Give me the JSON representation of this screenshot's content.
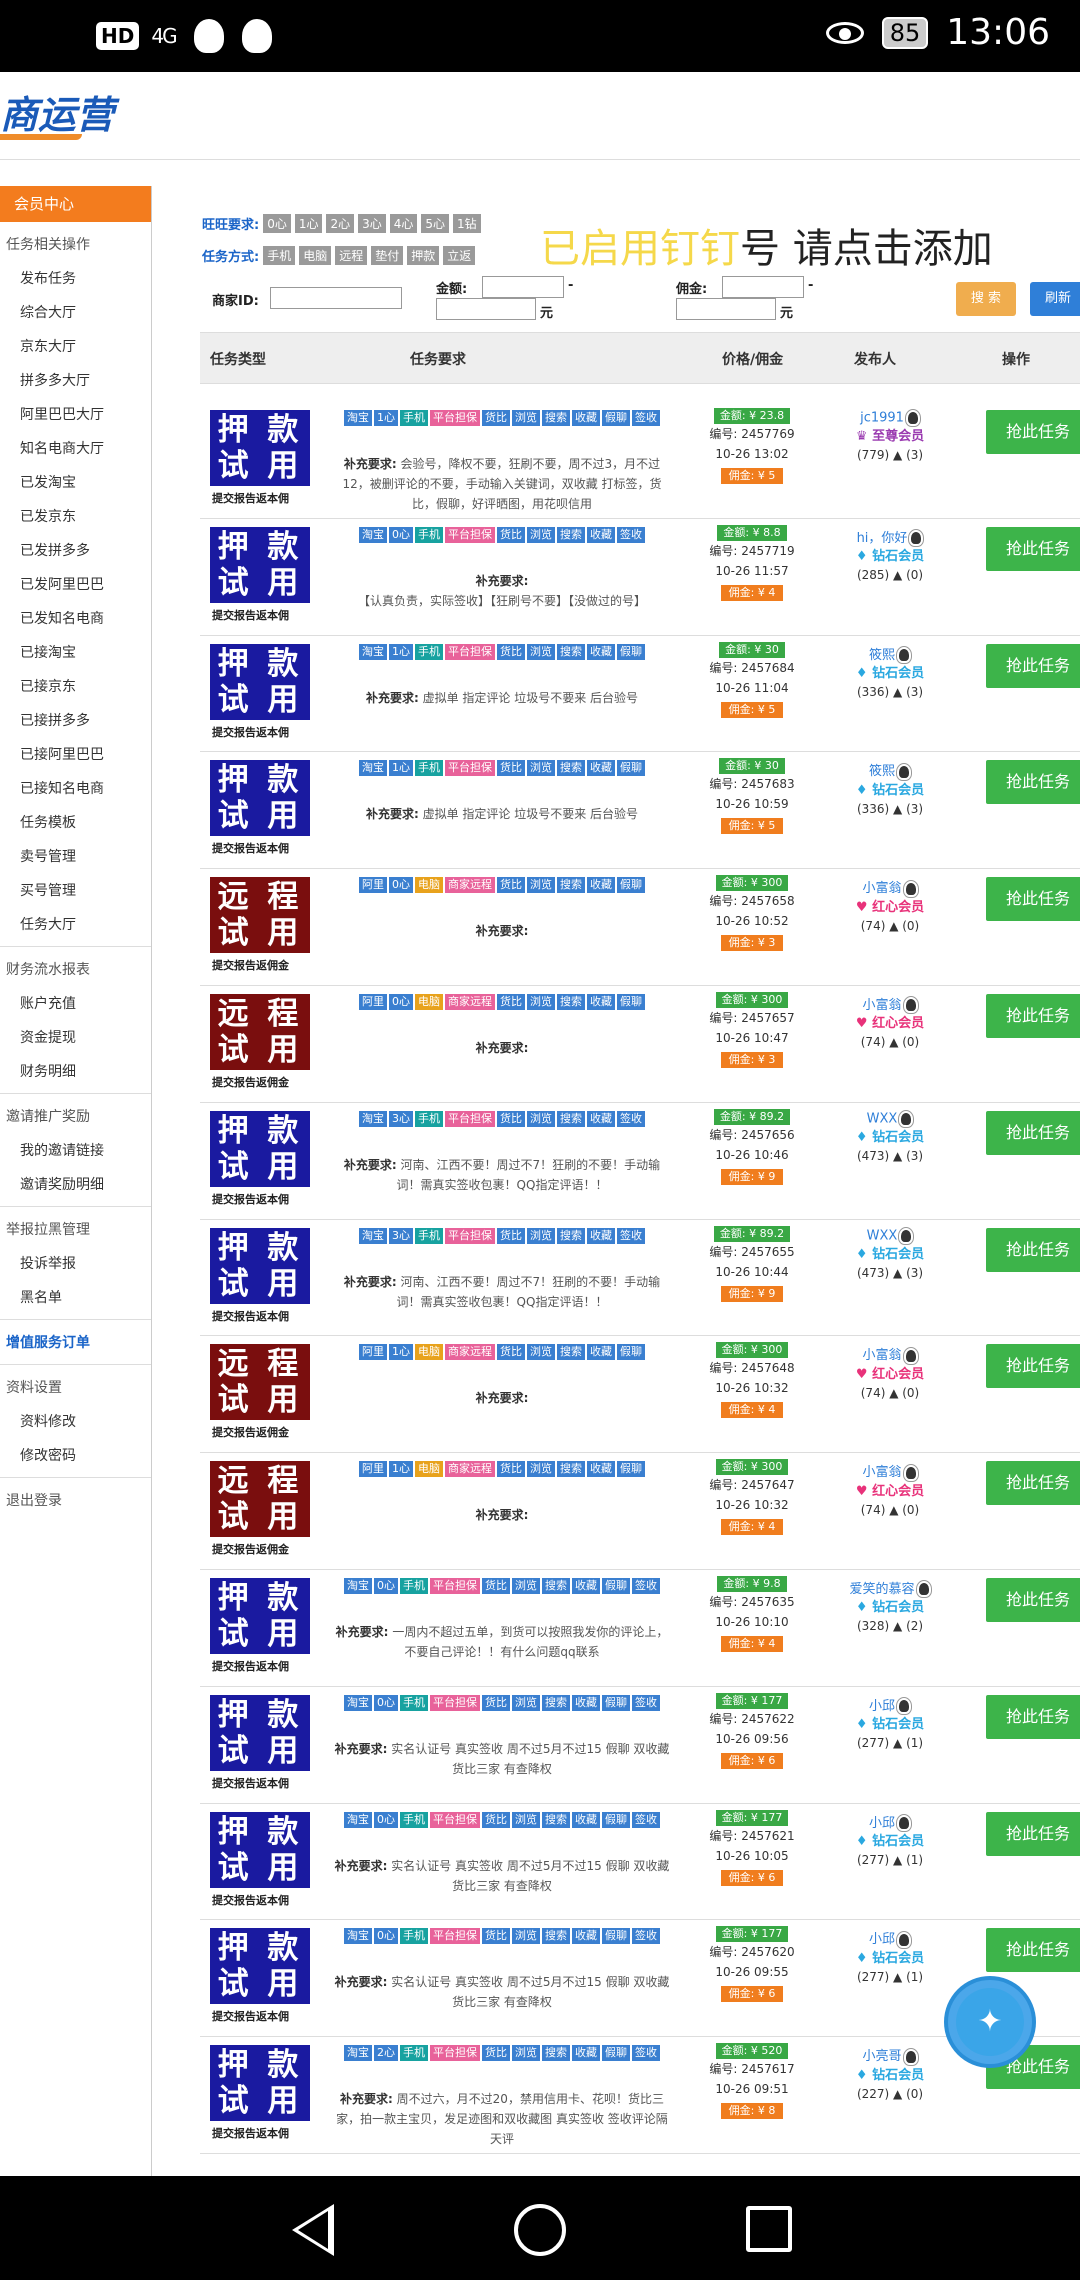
{
  "status_bar": {
    "hd": "HD",
    "signal": "4G",
    "battery": "85",
    "time": "13:06"
  },
  "header": {
    "logo": "商运营"
  },
  "sidebar": {
    "active": "会员中心",
    "groups": [
      {
        "title": "任务相关操作",
        "items": [
          "发布任务",
          "综合大厅",
          "京东大厅",
          "拼多多大厅",
          "阿里巴巴大厅",
          "知名电商大厅",
          "已发淘宝",
          "已发京东",
          "已发拼多多",
          "已发阿里巴巴",
          "已发知名电商",
          "已接淘宝",
          "已接京东",
          "已接拼多多",
          "已接阿里巴巴",
          "已接知名电商",
          "任务模板",
          "卖号管理",
          "买号管理",
          "任务大厅"
        ]
      },
      {
        "title": "财务流水报表",
        "items": [
          "账户充值",
          "资金提现",
          "财务明细"
        ]
      },
      {
        "title": "邀请推广奖励",
        "items": [
          "我的邀请链接",
          "邀请奖励明细"
        ]
      },
      {
        "title": "举报拉黑管理",
        "items": [
          "投诉举报",
          "黑名单"
        ]
      },
      {
        "title": "增值服务订单",
        "items": []
      },
      {
        "title": "资料设置",
        "items": [
          "资料修改",
          "修改密码"
        ]
      },
      {
        "title": "退出登录",
        "items": []
      }
    ]
  },
  "filters": {
    "wangwang_label": "旺旺要求:",
    "wangwang_chips": [
      "0心",
      "1心",
      "2心",
      "3心",
      "4心",
      "5心",
      "1钻"
    ],
    "method_label": "任务方式:",
    "method_chips": [
      "手机",
      "电脑",
      "远程",
      "垫付",
      "押款",
      "立返"
    ],
    "merchant_label": "商家ID:",
    "amount_label": "金额:",
    "commission_label": "佣金:",
    "dash": "-",
    "unit": "元",
    "search_btn": "搜 索",
    "refresh_btn": "刷新",
    "banner_yellow": "已启用钉钉",
    "banner_black": "号  请点击添加"
  },
  "table_header": {
    "type": "任务类型",
    "req": "任务要求",
    "price": "价格/佣金",
    "publisher": "发布人",
    "action": "操作"
  },
  "labels": {
    "req_prefix": "补充要求:",
    "id_prefix": "编号:",
    "grab": "抢此任务"
  },
  "rows": [
    {
      "badge": [
        "押 款",
        "试 用"
      ],
      "badge_color": "blue",
      "badge_sub": "提交报告返本佣",
      "tags": [
        [
          "淘宝",
          "blue"
        ],
        [
          "1心",
          "blue"
        ],
        [
          "手机",
          "teal"
        ],
        [
          "平台担保",
          "pink"
        ],
        [
          "货比",
          "blue"
        ],
        [
          "浏览",
          "blue"
        ],
        [
          "搜索",
          "blue"
        ],
        [
          "收藏",
          "blue"
        ],
        [
          "假聊",
          "blue"
        ],
        [
          "签收",
          "blue"
        ]
      ],
      "req": "会验号，降权不要，狂刷不要，周不过3，月不过12，被删评论的不要，手动输入关键词，双收藏 打标签，货比，假聊，好评晒图，用花呗信用",
      "amount": "金额: ¥ 23.8",
      "id": "2457769",
      "time": "10-26 13:02",
      "fee": "佣金: ¥ 5",
      "name": "jc1991",
      "level": "至尊会员",
      "level_type": "vip",
      "stats": "(779) ▲ (3)"
    },
    {
      "badge": [
        "押 款",
        "试 用"
      ],
      "badge_color": "blue",
      "badge_sub": "提交报告返本佣",
      "tags": [
        [
          "淘宝",
          "blue"
        ],
        [
          "0心",
          "blue"
        ],
        [
          "手机",
          "teal"
        ],
        [
          "平台担保",
          "pink"
        ],
        [
          "货比",
          "blue"
        ],
        [
          "浏览",
          "blue"
        ],
        [
          "搜索",
          "blue"
        ],
        [
          "收藏",
          "blue"
        ],
        [
          "签收",
          "blue"
        ]
      ],
      "req": "【认真负责，实际签收】【狂刷号不要】【没做过的号】",
      "amount": "金额: ¥ 8.8",
      "id": "2457719",
      "time": "10-26 11:57",
      "fee": "佣金: ¥ 4",
      "name": "hi，你好",
      "level": "钻石会员",
      "level_type": "diamond",
      "stats": "(285) ▲ (0)"
    },
    {
      "badge": [
        "押 款",
        "试 用"
      ],
      "badge_color": "blue",
      "badge_sub": "提交报告返本佣",
      "tags": [
        [
          "淘宝",
          "blue"
        ],
        [
          "1心",
          "blue"
        ],
        [
          "手机",
          "teal"
        ],
        [
          "平台担保",
          "pink"
        ],
        [
          "货比",
          "blue"
        ],
        [
          "浏览",
          "blue"
        ],
        [
          "搜索",
          "blue"
        ],
        [
          "收藏",
          "blue"
        ],
        [
          "假聊",
          "blue"
        ]
      ],
      "req": "虚拟单 指定评论 垃圾号不要来 后台验号",
      "amount": "金额: ¥ 30",
      "id": "2457684",
      "time": "10-26 11:04",
      "fee": "佣金: ¥ 5",
      "name": "筱熙",
      "level": "钻石会员",
      "level_type": "diamond",
      "stats": "(336) ▲ (3)"
    },
    {
      "badge": [
        "押 款",
        "试 用"
      ],
      "badge_color": "blue",
      "badge_sub": "提交报告返本佣",
      "tags": [
        [
          "淘宝",
          "blue"
        ],
        [
          "1心",
          "blue"
        ],
        [
          "手机",
          "teal"
        ],
        [
          "平台担保",
          "pink"
        ],
        [
          "货比",
          "blue"
        ],
        [
          "浏览",
          "blue"
        ],
        [
          "搜索",
          "blue"
        ],
        [
          "收藏",
          "blue"
        ],
        [
          "假聊",
          "blue"
        ]
      ],
      "req": "虚拟单 指定评论 垃圾号不要来 后台验号",
      "amount": "金额: ¥ 30",
      "id": "2457683",
      "time": "10-26 10:59",
      "fee": "佣金: ¥ 5",
      "name": "筱熙",
      "level": "钻石会员",
      "level_type": "diamond",
      "stats": "(336) ▲ (3)"
    },
    {
      "badge": [
        "远 程",
        "试 用"
      ],
      "badge_color": "red",
      "badge_sub": "提交报告返佣金",
      "tags": [
        [
          "阿里",
          "blue"
        ],
        [
          "0心",
          "blue"
        ],
        [
          "电脑",
          "org"
        ],
        [
          "商家远程",
          "pink"
        ],
        [
          "货比",
          "blue"
        ],
        [
          "浏览",
          "blue"
        ],
        [
          "搜索",
          "blue"
        ],
        [
          "收藏",
          "blue"
        ],
        [
          "假聊",
          "blue"
        ]
      ],
      "req": "",
      "amount": "金额: ¥ 300",
      "id": "2457658",
      "time": "10-26 10:52",
      "fee": "佣金: ¥ 3",
      "name": "小富翁",
      "level": "红心会员",
      "level_type": "heart",
      "stats": "(74) ▲ (0)"
    },
    {
      "badge": [
        "远 程",
        "试 用"
      ],
      "badge_color": "red",
      "badge_sub": "提交报告返佣金",
      "tags": [
        [
          "阿里",
          "blue"
        ],
        [
          "0心",
          "blue"
        ],
        [
          "电脑",
          "org"
        ],
        [
          "商家远程",
          "pink"
        ],
        [
          "货比",
          "blue"
        ],
        [
          "浏览",
          "blue"
        ],
        [
          "搜索",
          "blue"
        ],
        [
          "收藏",
          "blue"
        ],
        [
          "假聊",
          "blue"
        ]
      ],
      "req": "",
      "amount": "金额: ¥ 300",
      "id": "2457657",
      "time": "10-26 10:47",
      "fee": "佣金: ¥ 3",
      "name": "小富翁",
      "level": "红心会员",
      "level_type": "heart",
      "stats": "(74) ▲ (0)"
    },
    {
      "badge": [
        "押 款",
        "试 用"
      ],
      "badge_color": "blue",
      "badge_sub": "提交报告返本佣",
      "tags": [
        [
          "淘宝",
          "blue"
        ],
        [
          "3心",
          "blue"
        ],
        [
          "手机",
          "teal"
        ],
        [
          "平台担保",
          "pink"
        ],
        [
          "货比",
          "blue"
        ],
        [
          "浏览",
          "blue"
        ],
        [
          "搜索",
          "blue"
        ],
        [
          "收藏",
          "blue"
        ],
        [
          "签收",
          "blue"
        ]
      ],
      "req": "河南、江西不要！周过不7！狂刷的不要！手动输词！需真实签收包裹！QQ指定评语！！",
      "amount": "金额: ¥ 89.2",
      "id": "2457656",
      "time": "10-26 10:46",
      "fee": "佣金: ¥ 9",
      "name": "WXX",
      "level": "钻石会员",
      "level_type": "diamond",
      "stats": "(473) ▲ (3)"
    },
    {
      "badge": [
        "押 款",
        "试 用"
      ],
      "badge_color": "blue",
      "badge_sub": "提交报告返本佣",
      "tags": [
        [
          "淘宝",
          "blue"
        ],
        [
          "3心",
          "blue"
        ],
        [
          "手机",
          "teal"
        ],
        [
          "平台担保",
          "pink"
        ],
        [
          "货比",
          "blue"
        ],
        [
          "浏览",
          "blue"
        ],
        [
          "搜索",
          "blue"
        ],
        [
          "收藏",
          "blue"
        ],
        [
          "签收",
          "blue"
        ]
      ],
      "req": "河南、江西不要！周过不7！狂刷的不要！手动输词！需真实签收包裹！QQ指定评语！！",
      "amount": "金额: ¥ 89.2",
      "id": "2457655",
      "time": "10-26 10:44",
      "fee": "佣金: ¥ 9",
      "name": "WXX",
      "level": "钻石会员",
      "level_type": "diamond",
      "stats": "(473) ▲ (3)"
    },
    {
      "badge": [
        "远 程",
        "试 用"
      ],
      "badge_color": "red",
      "badge_sub": "提交报告返佣金",
      "tags": [
        [
          "阿里",
          "blue"
        ],
        [
          "1心",
          "blue"
        ],
        [
          "电脑",
          "org"
        ],
        [
          "商家远程",
          "pink"
        ],
        [
          "货比",
          "blue"
        ],
        [
          "浏览",
          "blue"
        ],
        [
          "搜索",
          "blue"
        ],
        [
          "收藏",
          "blue"
        ],
        [
          "假聊",
          "blue"
        ]
      ],
      "req": "",
      "amount": "金额: ¥ 300",
      "id": "2457648",
      "time": "10-26 10:32",
      "fee": "佣金: ¥ 4",
      "name": "小富翁",
      "level": "红心会员",
      "level_type": "heart",
      "stats": "(74) ▲ (0)"
    },
    {
      "badge": [
        "远 程",
        "试 用"
      ],
      "badge_color": "red",
      "badge_sub": "提交报告返佣金",
      "tags": [
        [
          "阿里",
          "blue"
        ],
        [
          "1心",
          "blue"
        ],
        [
          "电脑",
          "org"
        ],
        [
          "商家远程",
          "pink"
        ],
        [
          "货比",
          "blue"
        ],
        [
          "浏览",
          "blue"
        ],
        [
          "搜索",
          "blue"
        ],
        [
          "收藏",
          "blue"
        ],
        [
          "假聊",
          "blue"
        ]
      ],
      "req": "",
      "amount": "金额: ¥ 300",
      "id": "2457647",
      "time": "10-26 10:32",
      "fee": "佣金: ¥ 4",
      "name": "小富翁",
      "level": "红心会员",
      "level_type": "heart",
      "stats": "(74) ▲ (0)"
    },
    {
      "badge": [
        "押 款",
        "试 用"
      ],
      "badge_color": "blue",
      "badge_sub": "提交报告返本佣",
      "tags": [
        [
          "淘宝",
          "blue"
        ],
        [
          "0心",
          "blue"
        ],
        [
          "手机",
          "teal"
        ],
        [
          "平台担保",
          "pink"
        ],
        [
          "货比",
          "blue"
        ],
        [
          "浏览",
          "blue"
        ],
        [
          "搜索",
          "blue"
        ],
        [
          "收藏",
          "blue"
        ],
        [
          "假聊",
          "blue"
        ],
        [
          "签收",
          "blue"
        ]
      ],
      "req": "一周内不超过五单，到货可以按照我发你的评论上，不要自己评论！！有什么问题qq联系",
      "amount": "金额: ¥ 9.8",
      "id": "2457635",
      "time": "10-26 10:10",
      "fee": "佣金: ¥ 4",
      "name": "爱笑的慕容",
      "level": "钻石会员",
      "level_type": "diamond",
      "stats": "(328) ▲ (2)"
    },
    {
      "badge": [
        "押 款",
        "试 用"
      ],
      "badge_color": "blue",
      "badge_sub": "提交报告返本佣",
      "tags": [
        [
          "淘宝",
          "blue"
        ],
        [
          "0心",
          "blue"
        ],
        [
          "手机",
          "teal"
        ],
        [
          "平台担保",
          "pink"
        ],
        [
          "货比",
          "blue"
        ],
        [
          "浏览",
          "blue"
        ],
        [
          "搜索",
          "blue"
        ],
        [
          "收藏",
          "blue"
        ],
        [
          "假聊",
          "blue"
        ],
        [
          "签收",
          "blue"
        ]
      ],
      "req": "实名认证号 真实签收 周不过5月不过15 假聊 双收藏 货比三家 有查降权",
      "amount": "金额: ¥ 177",
      "id": "2457622",
      "time": "10-26 09:56",
      "fee": "佣金: ¥ 6",
      "name": "小邱",
      "level": "钻石会员",
      "level_type": "diamond",
      "stats": "(277) ▲ (1)"
    },
    {
      "badge": [
        "押 款",
        "试 用"
      ],
      "badge_color": "blue",
      "badge_sub": "提交报告返本佣",
      "tags": [
        [
          "淘宝",
          "blue"
        ],
        [
          "0心",
          "blue"
        ],
        [
          "手机",
          "teal"
        ],
        [
          "平台担保",
          "pink"
        ],
        [
          "货比",
          "blue"
        ],
        [
          "浏览",
          "blue"
        ],
        [
          "搜索",
          "blue"
        ],
        [
          "收藏",
          "blue"
        ],
        [
          "假聊",
          "blue"
        ],
        [
          "签收",
          "blue"
        ]
      ],
      "req": "实名认证号 真实签收 周不过5月不过15 假聊 双收藏 货比三家 有查降权",
      "amount": "金额: ¥ 177",
      "id": "2457621",
      "time": "10-26 10:05",
      "fee": "佣金: ¥ 6",
      "name": "小邱",
      "level": "钻石会员",
      "level_type": "diamond",
      "stats": "(277) ▲ (1)"
    },
    {
      "badge": [
        "押 款",
        "试 用"
      ],
      "badge_color": "blue",
      "badge_sub": "提交报告返本佣",
      "tags": [
        [
          "淘宝",
          "blue"
        ],
        [
          "0心",
          "blue"
        ],
        [
          "手机",
          "teal"
        ],
        [
          "平台担保",
          "pink"
        ],
        [
          "货比",
          "blue"
        ],
        [
          "浏览",
          "blue"
        ],
        [
          "搜索",
          "blue"
        ],
        [
          "收藏",
          "blue"
        ],
        [
          "假聊",
          "blue"
        ],
        [
          "签收",
          "blue"
        ]
      ],
      "req": "实名认证号 真实签收 周不过5月不过15 假聊 双收藏 货比三家 有查降权",
      "amount": "金额: ¥ 177",
      "id": "2457620",
      "time": "10-26 09:55",
      "fee": "佣金: ¥ 6",
      "name": "小邱",
      "level": "钻石会员",
      "level_type": "diamond",
      "stats": "(277) ▲ (1)"
    },
    {
      "badge": [
        "押 款",
        "试 用"
      ],
      "badge_color": "blue",
      "badge_sub": "提交报告返本佣",
      "tags": [
        [
          "淘宝",
          "blue"
        ],
        [
          "2心",
          "blue"
        ],
        [
          "手机",
          "teal"
        ],
        [
          "平台担保",
          "pink"
        ],
        [
          "货比",
          "blue"
        ],
        [
          "浏览",
          "blue"
        ],
        [
          "搜索",
          "blue"
        ],
        [
          "收藏",
          "blue"
        ],
        [
          "假聊",
          "blue"
        ],
        [
          "签收",
          "blue"
        ]
      ],
      "req": "周不过六，月不过20，禁用信用卡、花呗！货比三家，拍一款主宝贝，发足迹图和双收藏图 真实签收 签收评论隔天评",
      "amount": "金额: ¥ 520",
      "id": "2457617",
      "time": "10-26 09:51",
      "fee": "佣金: ¥ 8",
      "name": "小亮哥",
      "level": "钻石会员",
      "level_type": "diamond",
      "stats": "(227) ▲ (0)"
    }
  ],
  "colors": {
    "accent": "#f37c1e",
    "grab": "#3db44a",
    "link": "#2f7fd8"
  }
}
